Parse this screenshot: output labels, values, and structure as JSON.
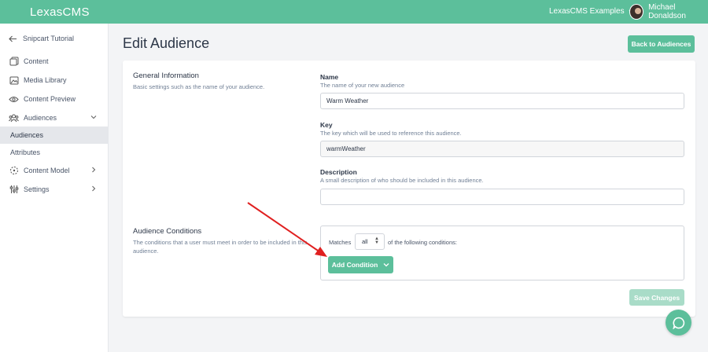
{
  "header": {
    "logo_main": "Lexas",
    "logo_suffix": "CMS",
    "workspace": "LexasCMS Examples",
    "user_name": "Michael Donaldson"
  },
  "sidebar": {
    "back_label": "Snipcart Tutorial",
    "items": [
      {
        "label": "Content",
        "icon": "content-icon"
      },
      {
        "label": "Media Library",
        "icon": "image-icon"
      },
      {
        "label": "Content Preview",
        "icon": "eye-icon"
      },
      {
        "label": "Audiences",
        "icon": "users-icon"
      },
      {
        "label": "Audiences",
        "icon": ""
      },
      {
        "label": "Attributes",
        "icon": ""
      },
      {
        "label": "Content Model",
        "icon": "model-icon"
      },
      {
        "label": "Settings",
        "icon": "sliders-icon"
      }
    ]
  },
  "page": {
    "title": "Edit Audience",
    "back_button": "Back to Audiences"
  },
  "general": {
    "title": "General Information",
    "description": "Basic settings such as the name of your audience."
  },
  "fields": {
    "name": {
      "label": "Name",
      "help": "The name of your new audience",
      "value": "Warm Weather"
    },
    "key": {
      "label": "Key",
      "help": "The key which will be used to reference this audience.",
      "value": "warmWeather"
    },
    "description": {
      "label": "Description",
      "help": "A small description of who should be included in this audience.",
      "value": ""
    }
  },
  "conditions": {
    "title": "Audience Conditions",
    "description": "The conditions that a user must meet in order to be included in this audience.",
    "matches_label": "Matches",
    "matches_value": "all",
    "following_label": "of the following conditions:",
    "add_button": "Add Condition"
  },
  "actions": {
    "save_button": "Save Changes"
  },
  "colors": {
    "brand": "#5cbf9b",
    "annotation_arrow": "#e02020"
  }
}
